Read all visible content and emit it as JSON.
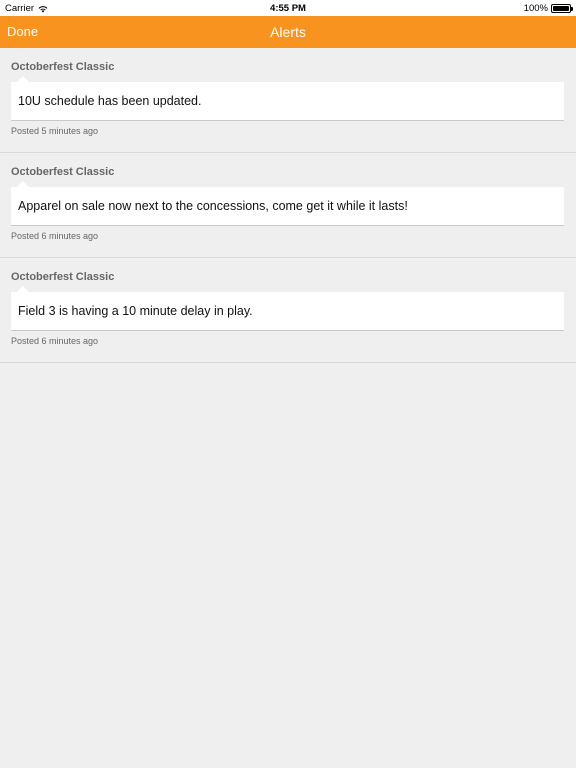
{
  "status_bar": {
    "carrier": "Carrier",
    "time": "4:55 PM",
    "battery": "100%"
  },
  "nav": {
    "done_label": "Done",
    "title": "Alerts",
    "accent_color": "#f7931e"
  },
  "alerts": [
    {
      "event": "Octoberfest Classic",
      "message": "10U schedule has been updated.",
      "posted": "Posted 5 minutes ago"
    },
    {
      "event": "Octoberfest Classic",
      "message": "Apparel on sale now next to the concessions, come get it while it lasts!",
      "posted": "Posted 6 minutes ago"
    },
    {
      "event": "Octoberfest Classic",
      "message": "Field 3 is having a 10 minute delay in play.",
      "posted": "Posted 6 minutes ago"
    }
  ]
}
